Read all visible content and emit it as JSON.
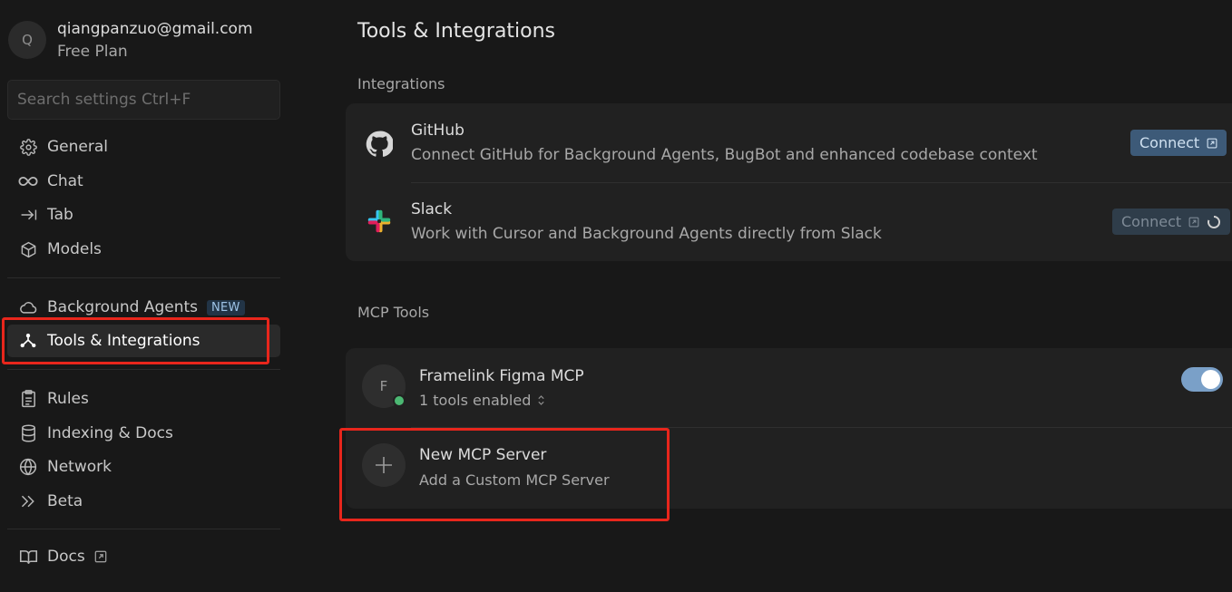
{
  "profile": {
    "initial": "Q",
    "email": "qiangpanzuo@gmail.com",
    "plan": "Free Plan"
  },
  "search": {
    "placeholder": "Search settings Ctrl+F"
  },
  "nav": {
    "general": "General",
    "chat": "Chat",
    "tab": "Tab",
    "models": "Models",
    "background_agents": "Background Agents",
    "new_badge": "NEW",
    "tools": "Tools & Integrations",
    "rules": "Rules",
    "indexing": "Indexing & Docs",
    "network": "Network",
    "beta": "Beta",
    "docs": "Docs"
  },
  "main": {
    "title": "Tools & Integrations",
    "integrations_label": "Integrations",
    "integrations": [
      {
        "name": "GitHub",
        "description": "Connect GitHub for Background Agents, BugBot and enhanced codebase context",
        "button": "Connect"
      },
      {
        "name": "Slack",
        "description": "Work with Cursor and Background Agents directly from Slack",
        "button": "Connect"
      }
    ],
    "mcp_label": "MCP Tools",
    "mcp_servers": [
      {
        "initial": "F",
        "name": "Framelink Figma MCP",
        "status": "1 tools enabled",
        "enabled": true
      }
    ],
    "new_server": {
      "title": "New MCP Server",
      "subtitle": "Add a Custom MCP Server"
    }
  },
  "colors": {
    "accent": "#3d5a78",
    "highlight": "#e8261c",
    "status_ok": "#4cb873",
    "toggle_on": "#7aa0c8"
  }
}
